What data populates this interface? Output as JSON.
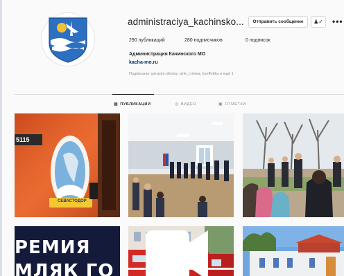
{
  "profile": {
    "username": "administraciya_kachinsko...",
    "message_button": "Отправить сообщение",
    "follow_icon": "person-check-icon",
    "more_icon": "more-dots-icon",
    "stats": {
      "posts": "290 публикаций",
      "followers": "280 подписчиков",
      "following": "0 подписок"
    },
    "full_name": "Администрация Качинского МО",
    "website": "kacha-mo.ru",
    "followed_by": "Подписаны: gerasim.nikolay, pink_crimea, konffettka и ещё 1"
  },
  "tabs": [
    {
      "label": "ПУБЛИКАЦИИ",
      "icon": "grid-icon",
      "active": true
    },
    {
      "label": "ВИДЕО",
      "icon": "video-icon",
      "active": false
    },
    {
      "label": "ОТМЕТКИ",
      "icon": "tag-icon",
      "active": false
    }
  ],
  "posts": {
    "tile1": {
      "bus_number": "5115",
      "badge_text": "СЕВАСТОДОР"
    },
    "tile4": {
      "line1": "РЕМИЯ",
      "line2": "МЛЯК ГО"
    }
  },
  "colors": {
    "accent_link": "#00376b",
    "text": "#262626",
    "muted": "#8e8e8e",
    "emblem_blue": "#2d6fc0",
    "bus_orange": "#e4622a"
  }
}
